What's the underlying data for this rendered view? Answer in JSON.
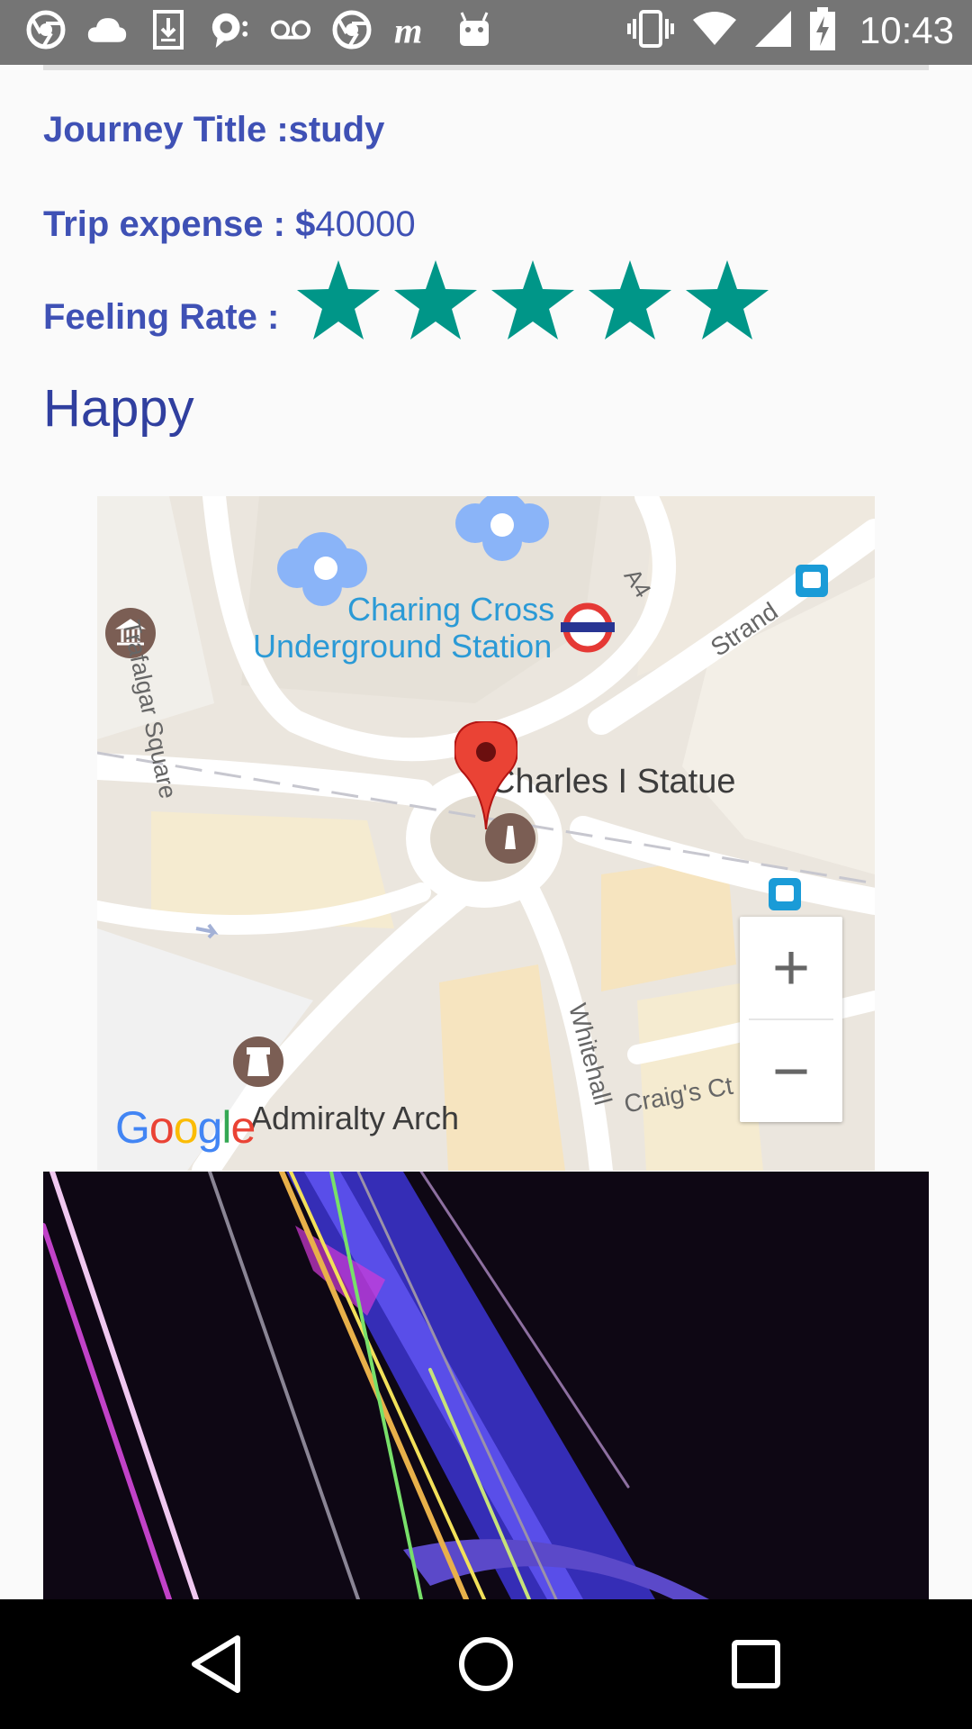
{
  "status_bar": {
    "time": "10:43",
    "left_icons": [
      "chrome-icon",
      "cloud-icon",
      "download-icon",
      "hangouts-icon",
      "voicemail-icon",
      "chrome-icon",
      "moto-icon",
      "android-icon"
    ],
    "right_icons": [
      "vibrate-icon",
      "wifi-icon",
      "signal-icon",
      "battery-charging-icon"
    ]
  },
  "journey": {
    "title_label": "Journey Title :",
    "title_value": "study",
    "expense_label": "Trip expense : $",
    "expense_value": "40000",
    "rating_label": "Feeling Rate :",
    "rating": 5,
    "rating_max": 5,
    "feeling": "Happy"
  },
  "map": {
    "station_line1": "Charing Cross",
    "station_line2": "Underground Station",
    "marker_label": "Charles I Statue",
    "street_trafalgar": "Trafalgar Square",
    "street_a4": "A4",
    "street_strand": "Strand",
    "street_whitehall": "Whitehall",
    "street_craigs": "Craig's Ct",
    "place_admiralty": "Admiralty Arch",
    "zoom_in": "+",
    "zoom_out": "−",
    "logo": [
      "G",
      "o",
      "o",
      "g",
      "l",
      "e"
    ],
    "colors": {
      "road": "#ffffff",
      "land": "#ebe6de",
      "water": "#8ab4f8",
      "station_text": "#2b9ad6",
      "building": "#f5ebd0"
    }
  },
  "nav_bar": {
    "icons": [
      "back-icon",
      "home-icon",
      "recents-icon"
    ]
  },
  "colors": {
    "accent": "#3f51b5",
    "star": "#009688",
    "statusbar": "#757575",
    "navbar": "#000000"
  }
}
